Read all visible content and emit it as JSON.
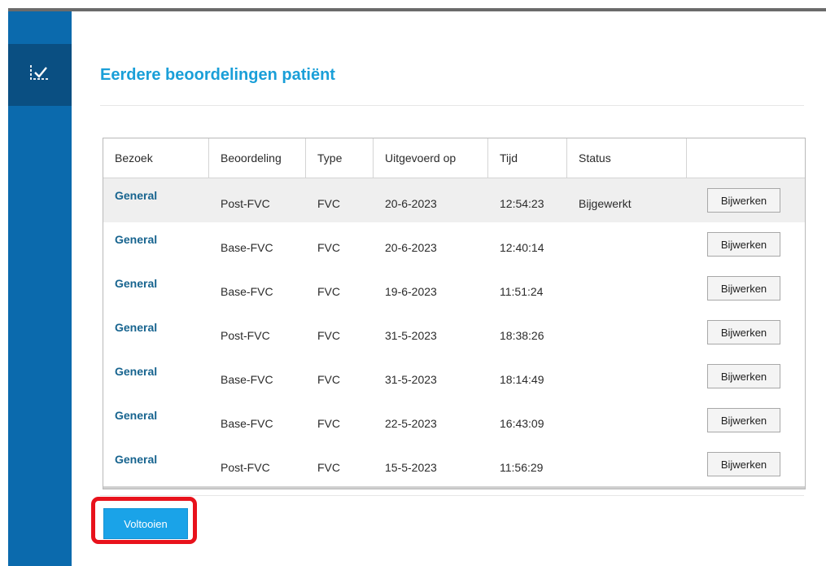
{
  "page": {
    "title": "Eerdere beoordelingen patiënt"
  },
  "sidebar": {
    "active_icon": "checklist-icon",
    "accent": "#0b6aad",
    "active_bg": "#0a4f82"
  },
  "table": {
    "headers": [
      "Bezoek",
      "Beoordeling",
      "Type",
      "Uitgevoerd op",
      "Tijd",
      "Status",
      ""
    ],
    "rows": [
      {
        "visit": "General",
        "assessment": "Post-FVC",
        "type": "FVC",
        "date": "20-6-2023",
        "time": "12:54:23",
        "status": "Bijgewerkt",
        "action": "Bijwerken"
      },
      {
        "visit": "General",
        "assessment": "Base-FVC",
        "type": "FVC",
        "date": "20-6-2023",
        "time": "12:40:14",
        "status": "",
        "action": "Bijwerken"
      },
      {
        "visit": "General",
        "assessment": "Base-FVC",
        "type": "FVC",
        "date": "19-6-2023",
        "time": "11:51:24",
        "status": "",
        "action": "Bijwerken"
      },
      {
        "visit": "General",
        "assessment": "Post-FVC",
        "type": "FVC",
        "date": "31-5-2023",
        "time": "18:38:26",
        "status": "",
        "action": "Bijwerken"
      },
      {
        "visit": "General",
        "assessment": "Base-FVC",
        "type": "FVC",
        "date": "31-5-2023",
        "time": "18:14:49",
        "status": "",
        "action": "Bijwerken"
      },
      {
        "visit": "General",
        "assessment": "Base-FVC",
        "type": "FVC",
        "date": "22-5-2023",
        "time": "16:43:09",
        "status": "",
        "action": "Bijwerken"
      },
      {
        "visit": "General",
        "assessment": "Post-FVC",
        "type": "FVC",
        "date": "15-5-2023",
        "time": "11:56:29",
        "status": "",
        "action": "Bijwerken"
      }
    ]
  },
  "footer": {
    "finish_label": "Voltooien"
  },
  "colors": {
    "title": "#1a9fd8",
    "link": "#17648f",
    "finish_button": "#1aa3e8",
    "highlight": "#e8121c",
    "selected_row": "#efefef"
  }
}
